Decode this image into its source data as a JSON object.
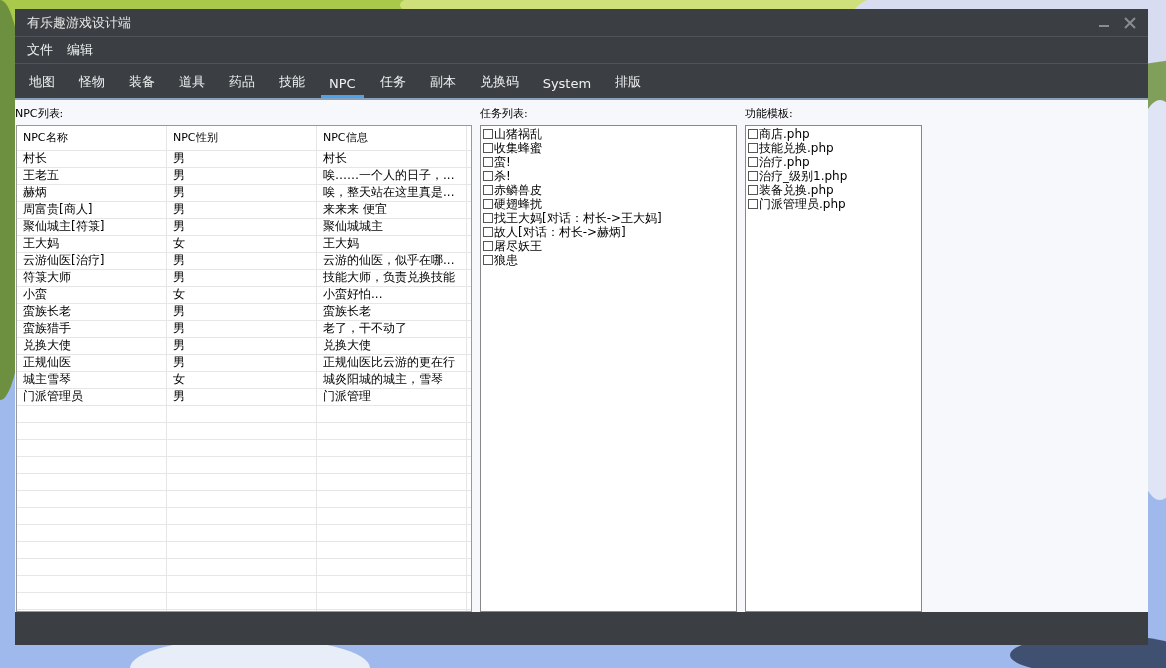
{
  "window": {
    "title": "有乐趣游戏设计端"
  },
  "menu": [
    "文件",
    "编辑"
  ],
  "tabs": [
    {
      "label": "地图",
      "selected": false
    },
    {
      "label": "怪物",
      "selected": false
    },
    {
      "label": "装备",
      "selected": false
    },
    {
      "label": "道具",
      "selected": false
    },
    {
      "label": "药品",
      "selected": false
    },
    {
      "label": "技能",
      "selected": false
    },
    {
      "label": "NPC",
      "selected": true
    },
    {
      "label": "任务",
      "selected": false
    },
    {
      "label": "副本",
      "selected": false
    },
    {
      "label": "兑换码",
      "selected": false
    },
    {
      "label": "System",
      "selected": false
    },
    {
      "label": "排版",
      "selected": false
    }
  ],
  "npc_list": {
    "label": "NPC列表:",
    "columns": [
      "NPC名称",
      "NPC性别",
      "NPC信息"
    ],
    "rows": [
      [
        "村长",
        "男",
        "村长"
      ],
      [
        "王老五",
        "男",
        "唉……一个人的日子，..."
      ],
      [
        "赫炳",
        "男",
        "唉，整天站在这里真是..."
      ],
      [
        "周富贵[商人]",
        "男",
        "来来来    便宜"
      ],
      [
        "聚仙城主[符箓]",
        "男",
        "聚仙城城主"
      ],
      [
        "王大妈",
        "女",
        "王大妈"
      ],
      [
        "云游仙医[治疗]",
        "男",
        "云游的仙医，似乎在哪..."
      ],
      [
        "符箓大师",
        "男",
        "技能大师，负责兑换技能"
      ],
      [
        "小蛮",
        "女",
        "小蛮好怕..."
      ],
      [
        "蛮族长老",
        "男",
        "蛮族长老"
      ],
      [
        "蛮族猎手",
        "男",
        "老了，干不动了"
      ],
      [
        "兑换大使",
        "男",
        "兑换大使"
      ],
      [
        "正规仙医",
        "男",
        "正规仙医比云游的更在行"
      ],
      [
        "城主雪琴",
        "女",
        "城炎阳城的城主，雪琴"
      ],
      [
        "门派管理员",
        "男",
        "门派管理"
      ]
    ]
  },
  "task_list": {
    "label": "任务列表:",
    "items": [
      {
        "text": "山猪祸乱",
        "checked": false
      },
      {
        "text": "收集蜂蜜",
        "checked": false
      },
      {
        "text": "蛮!",
        "checked": false
      },
      {
        "text": "杀!",
        "checked": false
      },
      {
        "text": "赤鳞兽皮",
        "checked": false
      },
      {
        "text": "硬翅蜂扰",
        "checked": false
      },
      {
        "text": "找王大妈[对话：村长->王大妈]",
        "checked": false
      },
      {
        "text": "故人[对话：村长->赫炳]",
        "checked": false
      },
      {
        "text": "屠尽妖王",
        "checked": false
      },
      {
        "text": "狼患",
        "checked": false
      }
    ]
  },
  "template_list": {
    "label": "功能模板:",
    "items": [
      {
        "text": "商店.php",
        "checked": false
      },
      {
        "text": "技能兑换.php",
        "checked": false
      },
      {
        "text": "治疗.php",
        "checked": false
      },
      {
        "text": "治疗_级别1.php",
        "checked": false
      },
      {
        "text": "装备兑换.php",
        "checked": false
      },
      {
        "text": "门派管理员.php",
        "checked": false
      }
    ]
  }
}
